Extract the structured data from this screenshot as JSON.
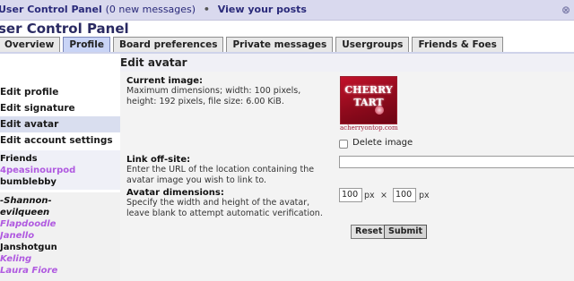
{
  "topbar": {
    "breadcrumb_link": "User Control Panel",
    "messages": "(0 new messages)",
    "separator": "•",
    "view_posts": "View your posts"
  },
  "page_title": "ser Control Panel",
  "tabs": [
    {
      "label": "Overview",
      "active": false
    },
    {
      "label": "Profile",
      "active": true
    },
    {
      "label": "Board preferences",
      "active": false
    },
    {
      "label": "Private messages",
      "active": false
    },
    {
      "label": "Usergroups",
      "active": false
    },
    {
      "label": "Friends & Foes",
      "active": false
    }
  ],
  "sidebar": {
    "items": [
      {
        "label": "Edit profile",
        "active": false
      },
      {
        "label": "Edit signature",
        "active": false
      },
      {
        "label": "Edit avatar",
        "active": true
      },
      {
        "label": "Edit account settings",
        "active": false
      }
    ],
    "friends_heading": "Friends",
    "friends": [
      "4peasinourpod",
      "bumblebby"
    ],
    "online": [
      {
        "name": "-Shannon-",
        "style": "dark-italic"
      },
      {
        "name": "evilqueen",
        "style": "dark-italic"
      },
      {
        "name": "Flapdoodle",
        "style": "purple-italic"
      },
      {
        "name": "Janello",
        "style": "purple-italic"
      },
      {
        "name": "Janshotgun",
        "style": "dark"
      },
      {
        "name": "Keling",
        "style": "purple-italic"
      },
      {
        "name": "Laura Fiore",
        "style": "purple-italic"
      }
    ]
  },
  "panel": {
    "heading": "Edit avatar",
    "current_image": {
      "title": "Current image:",
      "desc": "Maximum dimensions; width: 100 pixels, height: 192 pixels, file size: 6.00 KiB.",
      "avatar_line1": "CHERRY",
      "avatar_line2": "TART",
      "avatar_site": "acherryontop.com",
      "delete_label": "Delete image"
    },
    "link_offsite": {
      "title": "Link off-site:",
      "desc": "Enter the URL of the location containing the avatar image you wish to link to.",
      "value": ""
    },
    "dimensions": {
      "title": "Avatar dimensions:",
      "desc": "Specify the width and height of the avatar, leave blank to attempt automatic verification.",
      "width": "100",
      "height": "100",
      "unit": "px",
      "times": "×"
    },
    "buttons": {
      "reset": "Reset",
      "submit": "Submit"
    }
  },
  "colors": {
    "topbar_bg": "#d9d9ee",
    "active_tab": "#c9d4f6",
    "sidebar_active": "#d9deef",
    "friend_purple": "#b05ae0",
    "avatar_red": "#c2122a"
  }
}
